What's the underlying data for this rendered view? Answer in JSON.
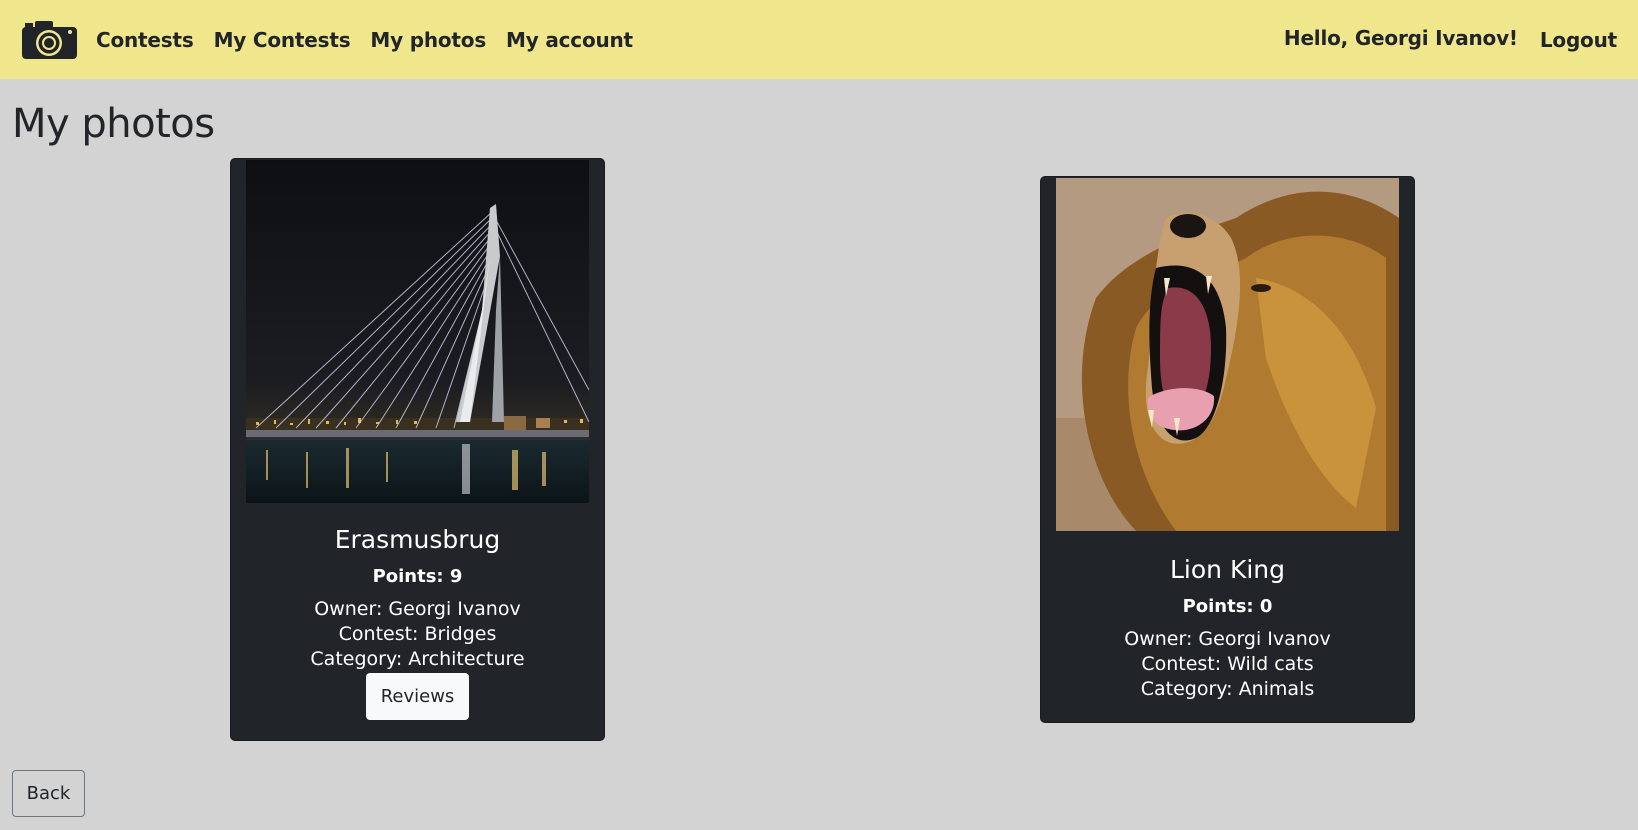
{
  "nav": {
    "brand_icon": "camera-icon",
    "links": [
      "Contests",
      "My Contests",
      "My photos",
      "My account"
    ],
    "greeting": "Hello, Georgi Ivanov!",
    "logout": "Logout"
  },
  "page": {
    "title": "My photos"
  },
  "photos": [
    {
      "title": "Erasmusbrug",
      "points": "Points: 9",
      "owner": "Owner: Georgi Ivanov",
      "contest": "Contest: Bridges",
      "category": "Category: Architecture",
      "reviews_label": "Reviews",
      "image": "bridge-night-photo"
    },
    {
      "title": "Lion King",
      "points": "Points: 0",
      "owner": "Owner: Georgi Ivanov",
      "contest": "Contest: Wild cats",
      "category": "Category: Animals",
      "image": "lion-roaring-photo"
    }
  ],
  "footer": {
    "back_label": "Back"
  },
  "colors": {
    "navbar": "#f0e68c",
    "background": "#d3d3d3",
    "card": "#212529"
  }
}
